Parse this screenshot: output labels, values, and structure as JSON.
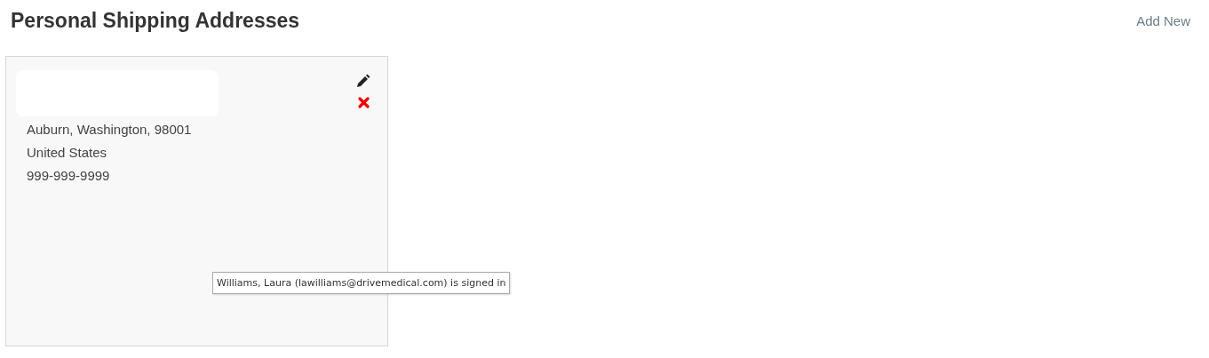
{
  "page_title": "Personal Shipping Addresses",
  "add_link": "Add New",
  "addresses": [
    {
      "lines": [
        "Auburn, Washington, 98001",
        "United States",
        "999-999-9999"
      ]
    }
  ],
  "tooltip": "Williams, Laura (lawilliams@drivemedical.com) is signed in"
}
